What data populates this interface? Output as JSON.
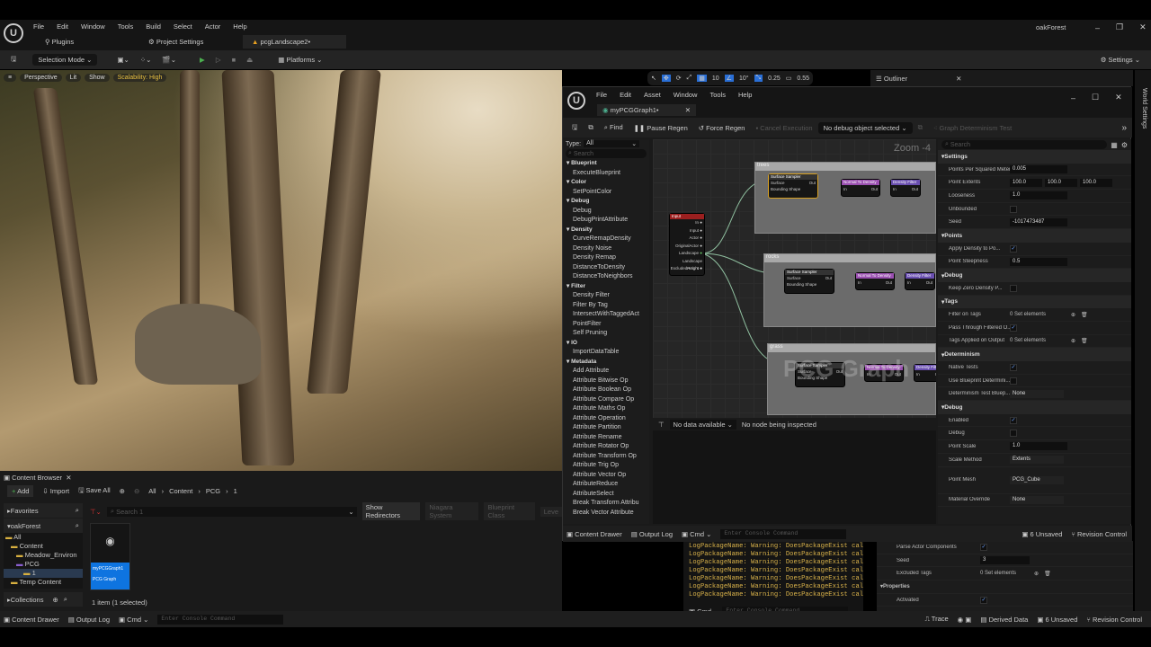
{
  "app": {
    "menu": [
      "File",
      "Edit",
      "Window",
      "Tools",
      "Build",
      "Select",
      "Actor",
      "Help"
    ],
    "project": "oakForest",
    "tabs": [
      {
        "label": "Plugins",
        "icon": "plug-icon"
      },
      {
        "label": "Project Settings",
        "icon": "gear-icon"
      },
      {
        "label": "pcgLandscape2•",
        "icon": "level-icon"
      }
    ],
    "toolbar": {
      "selection_mode": "Selection Mode",
      "platforms": "Platforms",
      "settings": "Settings"
    }
  },
  "viewport": {
    "perspective": "Perspective",
    "lit": "Lit",
    "show": "Show",
    "scalability": "Scalability: High",
    "snap": {
      "grid": "10",
      "rotation": "10°",
      "scale": "0.25",
      "camera": "0.55"
    }
  },
  "outliner": {
    "title": "Outliner",
    "world_settings": "World Settings"
  },
  "pcg": {
    "menu": [
      "File",
      "Edit",
      "Asset",
      "Window",
      "Tools",
      "Help"
    ],
    "tab": "myPCGGraph1•",
    "toolbar": {
      "find": "Find",
      "pause": "Pause Regen",
      "force": "Force Regen",
      "cancel": "Cancel Execution",
      "debug_object": "No debug object selected",
      "determinism": "Graph Determinism Test"
    },
    "palette": {
      "type_label": "Type:",
      "type_value": "All",
      "search_placeholder": "Search",
      "groups": [
        {
          "name": "Blueprint",
          "items": [
            "ExecuteBlueprint"
          ]
        },
        {
          "name": "Color",
          "items": [
            "SetPointColor"
          ]
        },
        {
          "name": "Debug",
          "items": [
            "Debug",
            "DebugPrintAttribute"
          ]
        },
        {
          "name": "Density",
          "items": [
            "CurveRemapDensity",
            "Density Noise",
            "Density Remap",
            "DistanceToDensity",
            "DistanceToNeighbors"
          ]
        },
        {
          "name": "Filter",
          "items": [
            "Density Filter",
            "Filter By Tag",
            "IntersectWithTaggedAct",
            "PointFilter",
            "Self Pruning"
          ]
        },
        {
          "name": "IO",
          "items": [
            "ImportDataTable"
          ]
        },
        {
          "name": "Metadata",
          "items": [
            "Add Attribute",
            "Attribute Bitwise Op",
            "Attribute Boolean Op",
            "Attribute Compare Op",
            "Attribute Maths Op",
            "Attribute Operation",
            "Attribute Partition",
            "Attribute Rename",
            "Attribute Rotator Op",
            "Attribute Transform Op",
            "Attribute Trig Op",
            "Attribute Vector Op",
            "AttributeReduce",
            "AttributeSelect",
            "Break Transform Attribu",
            "Break Vector Attribute"
          ]
        }
      ]
    },
    "graph": {
      "zoom": "Zoom -4",
      "watermark": "PCG Graph",
      "input_node": {
        "title": "Input",
        "pins": [
          "In",
          "Input",
          "Actor",
          "OriginalActor",
          "Landscape",
          "Landscape Height",
          "ExcludedActors"
        ]
      },
      "comments": [
        {
          "title": "trees"
        },
        {
          "title": "rocks"
        },
        {
          "title": "grass"
        }
      ],
      "node_titles": {
        "sampler": "Surface Sampler",
        "normal": "Normal To Density",
        "filter": "Density Filter"
      },
      "pins": {
        "surface": "Surface",
        "bounding": "Bounding Shape",
        "out": "Out",
        "in": "In"
      },
      "inspect_data": "No data available",
      "inspect_status": "No node being inspected"
    },
    "details": {
      "search_placeholder": "Search",
      "sections": [
        {
          "name": "Settings",
          "rows": [
            {
              "label": "Points Per Squared Meter",
              "value": "0.005"
            },
            {
              "label": "Point Extents",
              "values": [
                "100.0",
                "100.0",
                "100.0"
              ]
            },
            {
              "label": "Looseness",
              "value": "1.0"
            },
            {
              "label": "Unbounded",
              "check": false
            },
            {
              "label": "Seed",
              "value": "-1017473487"
            }
          ]
        },
        {
          "name": "Points",
          "rows": [
            {
              "label": "Apply Density to Po...",
              "check": true
            },
            {
              "label": "Point Steepness",
              "value": "0.5"
            }
          ]
        },
        {
          "name": "Debug",
          "rows": [
            {
              "label": "Keep Zero Density P...",
              "check": false
            }
          ]
        },
        {
          "name": "Tags",
          "rows": [
            {
              "label": "Filter on Tags",
              "text": "0 Set elements"
            },
            {
              "label": "Pass Through Filtered O...",
              "check": true
            },
            {
              "label": "Tags Applied on Output",
              "text": "0 Set elements"
            }
          ]
        },
        {
          "name": "Determinism",
          "rows": [
            {
              "label": "Native Tests",
              "check": true
            },
            {
              "label": "Use Blueprint Determini...",
              "check": false
            },
            {
              "label": "Determinism Test Bluep...",
              "value": "None"
            }
          ]
        },
        {
          "name": "Debug",
          "rows": [
            {
              "label": "Enabled",
              "check": true
            },
            {
              "label": "Debug",
              "check": false
            },
            {
              "label": "Point Scale",
              "value": "1.0"
            },
            {
              "label": "Scale Method",
              "value": "Extents"
            },
            {
              "label": "Point Mesh",
              "value": "PCG_Cube"
            },
            {
              "label": "Material Override",
              "value": "None"
            }
          ]
        }
      ]
    },
    "status": {
      "content_drawer": "Content Drawer",
      "output_log": "Output Log",
      "cmd": "Cmd",
      "console_placeholder": "Enter Console Command",
      "unsaved": "6 Unsaved",
      "revision": "Revision Control"
    }
  },
  "log": {
    "lines": [
      "LogPackageName: Warning: DoesPackageExist cal",
      "LogPackageName: Warning: DoesPackageExist cal",
      "LogPackageName: Warning: DoesPackageExist cal",
      "LogPackageName: Warning: DoesPackageExist cal",
      "LogPackageName: Warning: DoesPackageExist cal",
      "LogPackageName: Warning: DoesPackageExist cal",
      "LogPackageName: Warning: DoesPackageExist cal"
    ]
  },
  "bg_details": {
    "rows": [
      {
        "label": "Parse Actor Components",
        "check": true
      },
      {
        "label": "Seed",
        "value": "3"
      },
      {
        "label": "Excluded Tags",
        "text": "0 Set elements"
      }
    ],
    "section": "Properties",
    "activated": "Activated"
  },
  "content_browser": {
    "title": "Content Browser",
    "add": "Add",
    "import": "Import",
    "save_all": "Save All",
    "breadcrumb": [
      "All",
      "Content",
      "PCG",
      "1"
    ],
    "favorites": "Favorites",
    "root": "oakForest",
    "tree": [
      "All",
      "Content",
      "Meadow_Environ",
      "PCG",
      "1",
      "Temp Content"
    ],
    "collections": "Collections",
    "search_placeholder": "Search 1",
    "filters": [
      "Show Redirectors",
      "Niagara System",
      "Blueprint Class",
      "Leve"
    ],
    "asset": {
      "name": "myPCGGraph1",
      "type": "PCG Graph"
    },
    "count": "1 item (1 selected)"
  },
  "bottom": {
    "content_drawer": "Content Drawer",
    "output_log": "Output Log",
    "cmd": "Cmd",
    "console_placeholder": "Enter Console Command",
    "trace": "Trace",
    "derived_data": "Derived Data",
    "unsaved": "6 Unsaved",
    "revision": "Revision Control"
  }
}
